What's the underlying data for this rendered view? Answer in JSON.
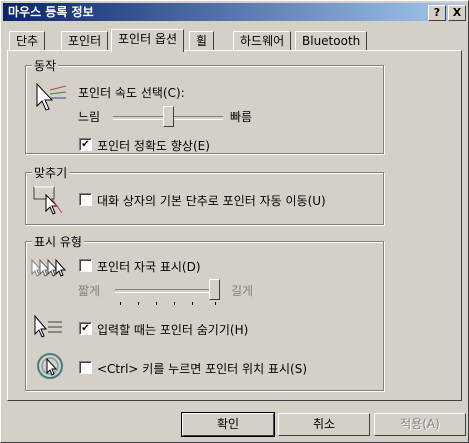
{
  "window": {
    "title": "마우스 등록 정보"
  },
  "titlebar": {
    "help_label": "?",
    "close_label": "X"
  },
  "tabs": [
    {
      "label": "단추"
    },
    {
      "label": "포인터"
    },
    {
      "label": "포인터 옵션"
    },
    {
      "label": "휠"
    },
    {
      "label": "하드웨어"
    },
    {
      "label": "Bluetooth"
    }
  ],
  "motion": {
    "group_title": "동작",
    "speed_label": "포인터 속도 선택(C):",
    "slow_label": "느림",
    "fast_label": "빠름",
    "speed_value_fraction": 0.5,
    "precision_label": "포인터 정확도 향상(E)",
    "precision_checked": true
  },
  "snap": {
    "group_title": "맞추기",
    "snap_label": "대화 상자의 기본 단추로 포인터 자동 이동(U)",
    "snap_checked": false
  },
  "visibility": {
    "group_title": "표시 유형",
    "trails_label": "포인터 자국 표시(D)",
    "trails_checked": false,
    "short_label": "짧게",
    "long_label": "길게",
    "trail_value_fraction": 1.0,
    "hide_label": "입력할 때는 포인터 숨기기(H)",
    "hide_checked": true,
    "ctrl_label": "<Ctrl> 키를 누르면 포인터 위치 표시(S)",
    "ctrl_checked": false
  },
  "buttons": {
    "ok": "확인",
    "cancel": "취소",
    "apply": "적용(A)"
  }
}
